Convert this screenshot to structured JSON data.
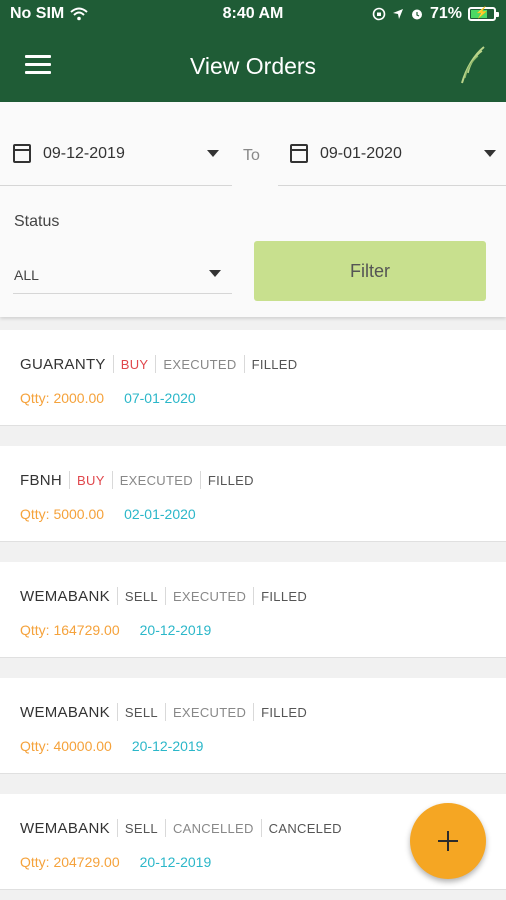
{
  "status_bar": {
    "carrier": "No SIM",
    "time": "8:40 AM",
    "battery": "71%",
    "battery_level": 0.71
  },
  "header": {
    "title": "View Orders",
    "menu_icon": "hamburger-menu-icon",
    "logo_icon": "leaf-icon"
  },
  "filters": {
    "from_date": "09-12-2019",
    "to_label": "To",
    "to_date": "09-01-2020",
    "status_label": "Status",
    "status_value": "ALL",
    "filter_button": "Filter"
  },
  "colors": {
    "header": "#1f5c36",
    "filter_button": "#c8e08e",
    "buy": "#e0474c",
    "qty": "#f5a23b",
    "date": "#2bb7c9",
    "fab": "#f5a623"
  },
  "orders": [
    {
      "symbol": "GUARANTY",
      "side": "BUY",
      "state": "EXECUTED",
      "fill": "FILLED",
      "qty": "Qtty: 2000.00",
      "date": "07-01-2020"
    },
    {
      "symbol": "FBNH",
      "side": "BUY",
      "state": "EXECUTED",
      "fill": "FILLED",
      "qty": "Qtty: 5000.00",
      "date": "02-01-2020"
    },
    {
      "symbol": "WEMABANK",
      "side": "SELL",
      "state": "EXECUTED",
      "fill": "FILLED",
      "qty": "Qtty: 164729.00",
      "date": "20-12-2019"
    },
    {
      "symbol": "WEMABANK",
      "side": "SELL",
      "state": "EXECUTED",
      "fill": "FILLED",
      "qty": "Qtty: 40000.00",
      "date": "20-12-2019"
    },
    {
      "symbol": "WEMABANK",
      "side": "SELL",
      "state": "CANCELLED",
      "fill": "CANCELED",
      "qty": "Qtty: 204729.00",
      "date": "20-12-2019"
    }
  ],
  "fab": {
    "icon": "plus-icon"
  }
}
